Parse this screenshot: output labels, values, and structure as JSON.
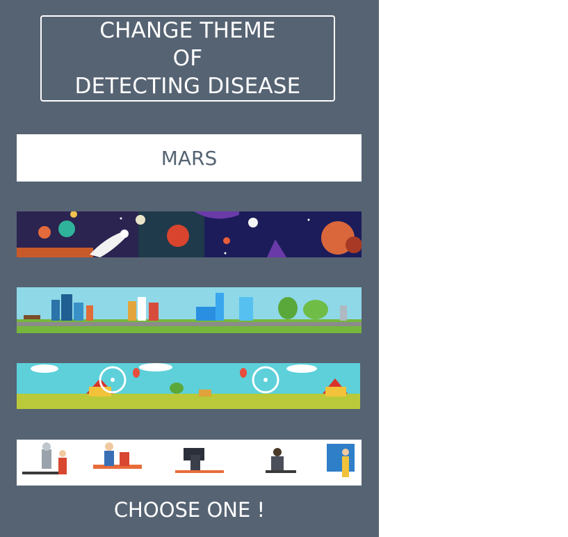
{
  "title": {
    "lines": [
      "CHANGE THEME",
      "OF",
      "DETECTING DISEASE"
    ]
  },
  "selected_theme": "MARS",
  "themes": [
    {
      "name": "space",
      "icon": "space-banner"
    },
    {
      "name": "city",
      "icon": "city-banner"
    },
    {
      "name": "amusement-park",
      "icon": "park-banner"
    },
    {
      "name": "office",
      "icon": "office-banner"
    }
  ],
  "footer": "CHOOSE ONE !",
  "colors": {
    "panel": "#566373",
    "accent_text": "#566373",
    "background": "#ffffff"
  }
}
